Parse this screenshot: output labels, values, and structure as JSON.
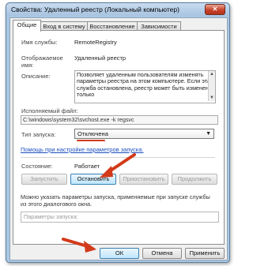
{
  "window": {
    "title": "Свойства: Удаленный реестр (Локальный компьютер)",
    "close_glyph": "✕"
  },
  "tabs": [
    {
      "label": "Общие",
      "active": true
    },
    {
      "label": "Вход в систему",
      "active": false
    },
    {
      "label": "Восстановление",
      "active": false
    },
    {
      "label": "Зависимости",
      "active": false
    }
  ],
  "general": {
    "service_name_label": "Имя службы:",
    "service_name": "RemoteRegistry",
    "display_name_label": "Отображаемое имя:",
    "display_name": "Удаленный реестр",
    "description_label": "Описание:",
    "description": "Позволяет удаленным пользователям изменять параметры реестра на этом компьютере. Если эта служба остановлена, реестр может быть изменен только",
    "exe_label": "Исполняемый файл:",
    "exe_path": "C:\\windows\\system32\\svchost.exe -k regsvc",
    "startup_label": "Тип запуска:",
    "startup_value": "Отключена",
    "help_link": "Помощь при настройке параметров запуска.",
    "state_label": "Состояние:",
    "state_value": "Работает",
    "buttons": {
      "start": "Запустить",
      "stop": "Остановить",
      "pause": "Приостановить",
      "resume": "Продолжить"
    },
    "params_note": "Можно указать параметры запуска, применяемые при запуске службы из этого диалогового окна.",
    "params_label": "Параметры запуска:"
  },
  "footer": {
    "ok": "ОК",
    "cancel": "Отмена",
    "apply": "Применить"
  },
  "colors": {
    "annotation_red": "#d23a1a",
    "link_blue": "#1a4fc0",
    "window_frame": "#aac7e3"
  }
}
